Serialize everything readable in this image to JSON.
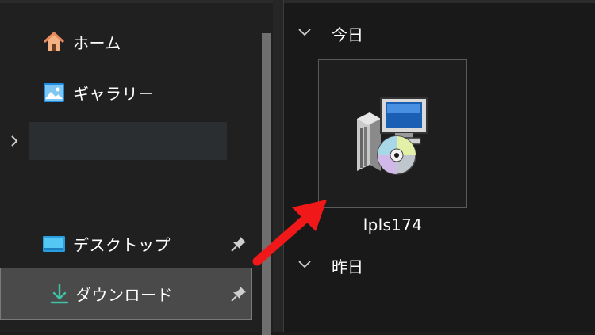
{
  "sidebar": {
    "items": [
      {
        "label": "ホーム",
        "icon": "home-icon"
      },
      {
        "label": "ギャラリー",
        "icon": "gallery-icon"
      },
      {
        "label": "デスクトップ",
        "icon": "desktop-folder-icon",
        "pinned": true
      },
      {
        "label": "ダウンロード",
        "icon": "download-icon",
        "pinned": true,
        "selected": true
      }
    ]
  },
  "content": {
    "groups": [
      {
        "label": "今日",
        "expanded": true
      },
      {
        "label": "昨日",
        "expanded": true
      }
    ],
    "files": [
      {
        "name": "lpls174",
        "icon": "installer-icon"
      }
    ]
  },
  "colors": {
    "background": "#191919",
    "sidebar": "#202020",
    "selected": "#4a4a4a",
    "download_icon": "#3dc2a5",
    "arrow": "#f01818"
  }
}
